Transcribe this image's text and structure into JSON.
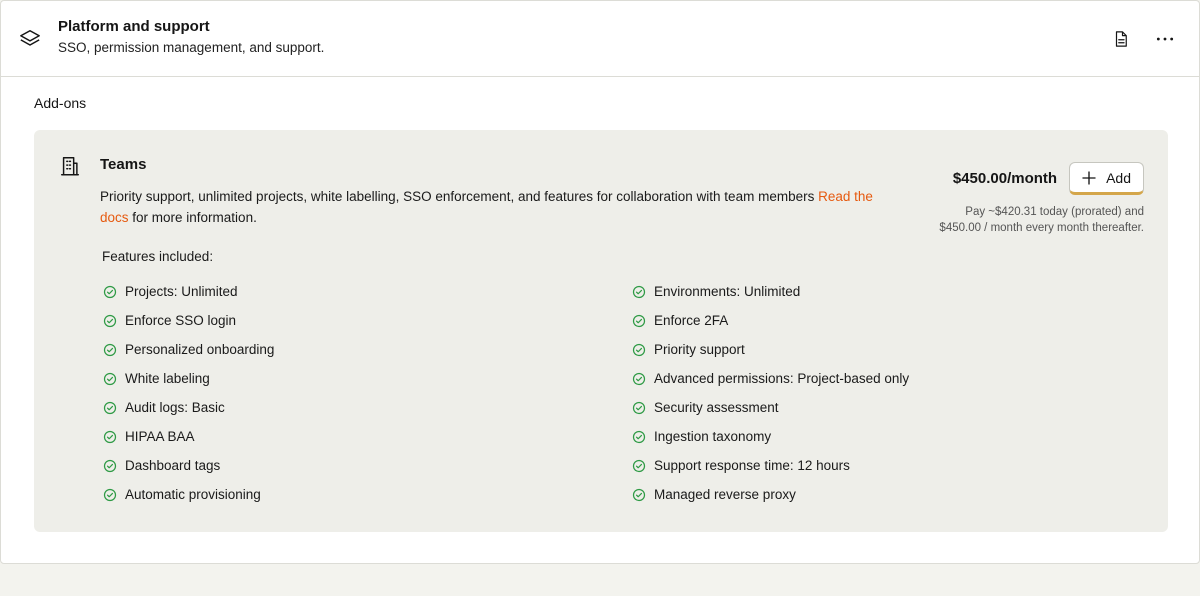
{
  "header": {
    "title": "Platform and support",
    "subtitle": "SSO, permission management, and support.",
    "icon": "layers-icon",
    "actions": [
      "document-icon",
      "more-dots-icon"
    ]
  },
  "section_label": "Add-ons",
  "addon": {
    "icon": "building-icon",
    "name": "Teams",
    "description": "Priority support, unlimited projects, white labelling, SSO enforcement, and features for collaboration with team members ",
    "docs_link": "Read the docs",
    "description_suffix": " for more information.",
    "price": "$450.00",
    "price_period": "/month",
    "add_label": "Add",
    "pay_note_line1": "Pay ~$420.31 today (prorated) and",
    "pay_note_line2": "$450.00 / month every month thereafter.",
    "features_label": "Features included:",
    "features": [
      "Projects: Unlimited",
      "Environments: Unlimited",
      "Enforce SSO login",
      "Enforce 2FA",
      "Personalized onboarding",
      "Priority support",
      "White labeling",
      "Advanced permissions: Project-based only",
      "Audit logs: Basic",
      "Security assessment",
      "HIPAA BAA",
      "Ingestion taxonomy",
      "Dashboard tags",
      "Support response time: 12 hours",
      "Automatic provisioning",
      "Managed reverse proxy"
    ]
  },
  "colors": {
    "accent_link": "#e65a10",
    "check_green": "#2e9a45",
    "card_bg": "#eeeee9",
    "button_underline": "#d4a64a"
  }
}
